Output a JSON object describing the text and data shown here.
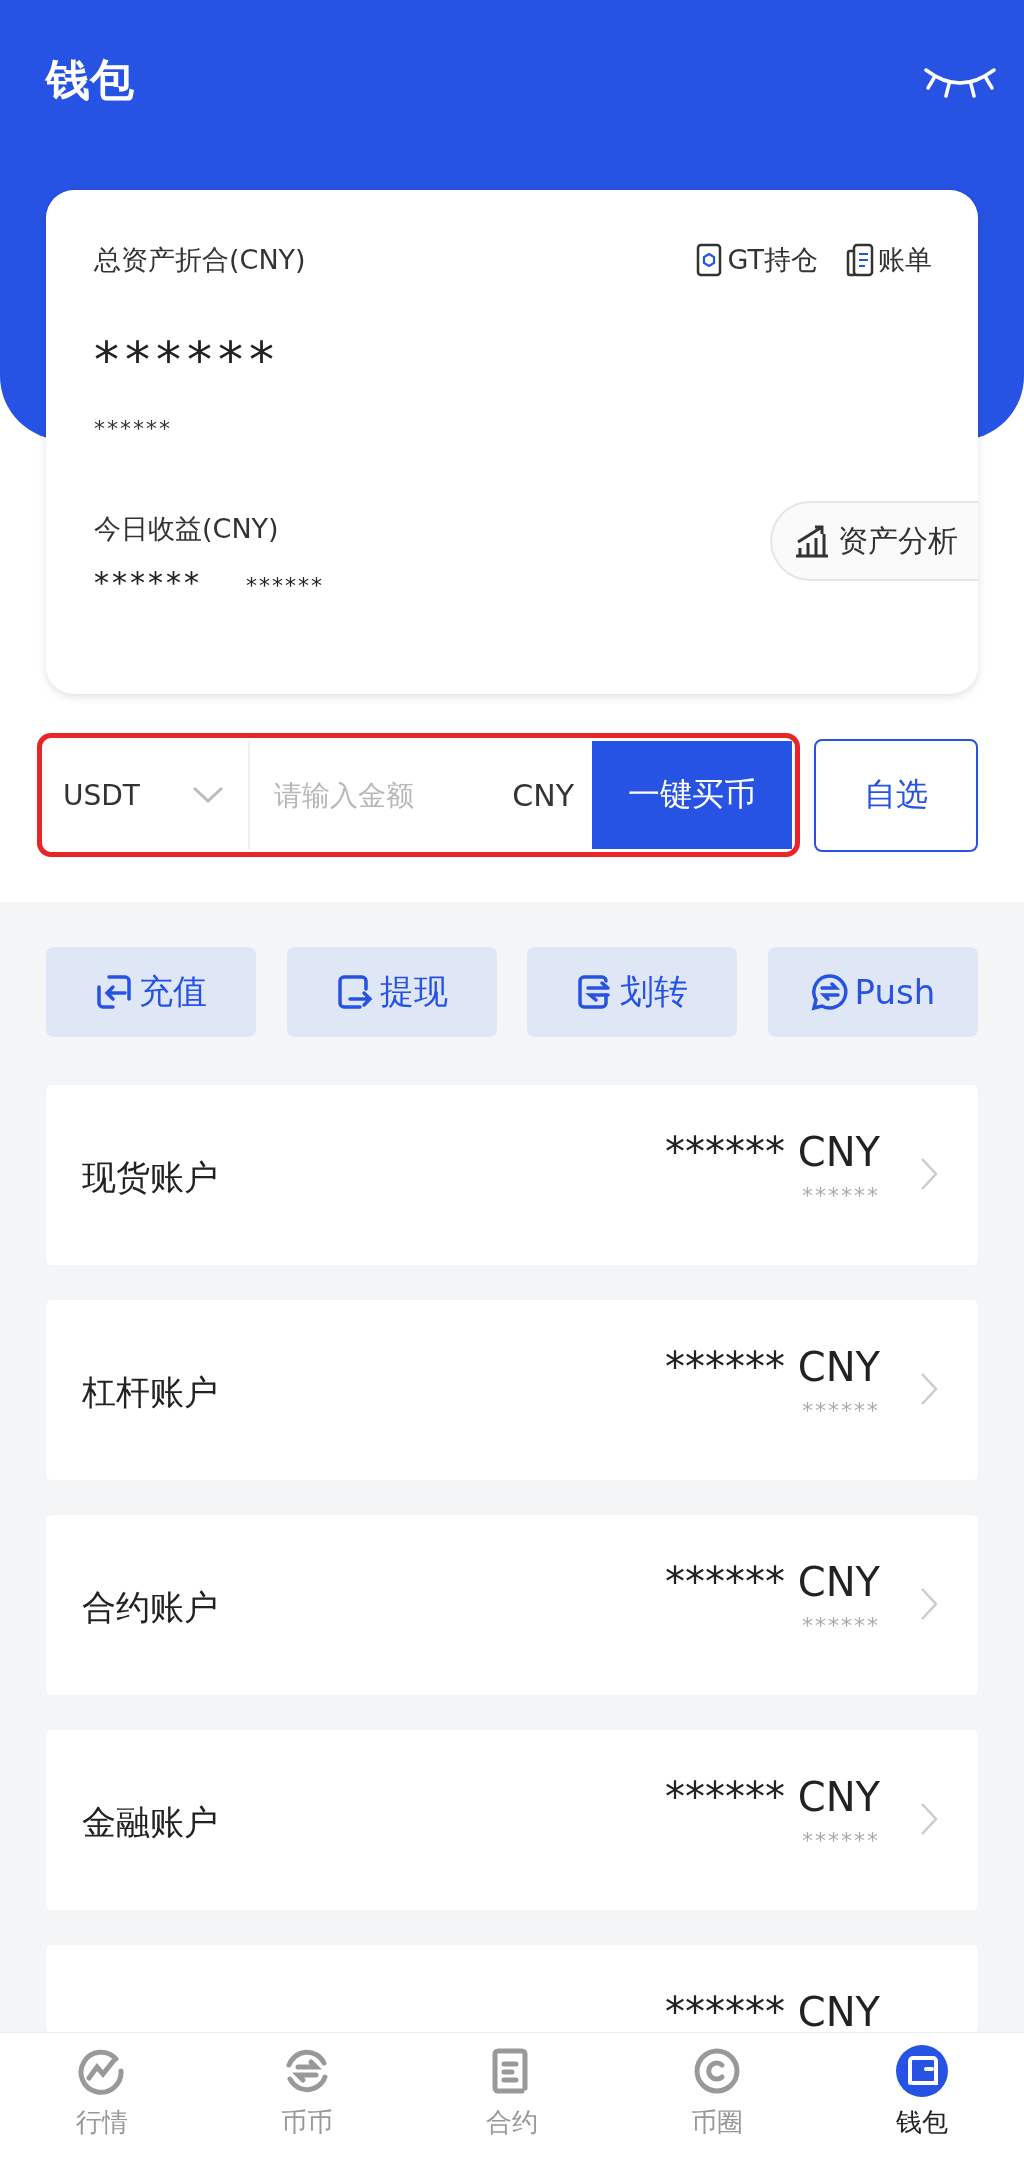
{
  "header": {
    "title": "钱包"
  },
  "asset_card": {
    "total_label": "总资产折合(CNY)",
    "links": [
      {
        "label": "GT持仓"
      },
      {
        "label": "账单"
      }
    ],
    "total_value": "******",
    "total_secondary": "******",
    "today_label": "今日收益(CNY)",
    "today_value": "******",
    "today_rate": "******",
    "analysis_button": "资产分析"
  },
  "buy_bar": {
    "currency": "USDT",
    "amount": {
      "placeholder": "请输入金额"
    },
    "unit": "CNY",
    "buy_button": "一键买币"
  },
  "watchlist_button": "自选",
  "actions": [
    {
      "label": "充值"
    },
    {
      "label": "提现"
    },
    {
      "label": "划转"
    },
    {
      "label": "Push"
    }
  ],
  "accounts": [
    {
      "name": "现货账户",
      "value": "****** CNY",
      "secondary": "******"
    },
    {
      "name": "杠杆账户",
      "value": "****** CNY",
      "secondary": "******"
    },
    {
      "name": "合约账户",
      "value": "****** CNY",
      "secondary": "******"
    },
    {
      "name": "金融账户",
      "value": "****** CNY",
      "secondary": "******"
    },
    {
      "value": "****** CNY"
    }
  ],
  "tab_bar": [
    {
      "label": "行情",
      "selected": false
    },
    {
      "label": "币币",
      "selected": false
    },
    {
      "label": "合约",
      "selected": false
    },
    {
      "label": "币圈",
      "selected": false
    },
    {
      "label": "钱包",
      "selected": true
    }
  ]
}
